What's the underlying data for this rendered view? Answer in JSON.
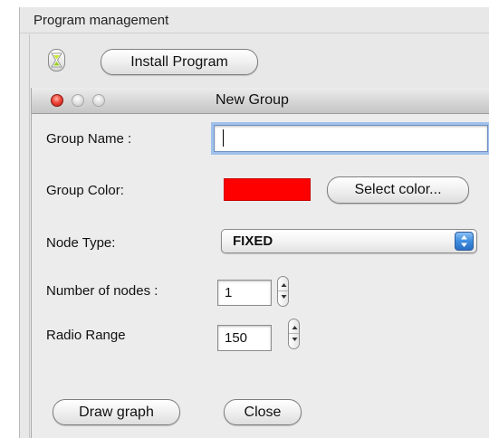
{
  "outer_window": {
    "title": "Program management",
    "install_button_label": "Install Program",
    "hourglass_icon": "hourglass-icon"
  },
  "dialog": {
    "title": "New Group",
    "traffic_lights": {
      "close_color": "#f0473a",
      "minimize_color": "#d4d4d4",
      "maximize_color": "#d4d4d4"
    },
    "group_name": {
      "label": "Group Name :",
      "value": "",
      "placeholder": ""
    },
    "group_color": {
      "label": "Group Color:",
      "swatch_color": "#ff0000",
      "select_button_label": "Select color..."
    },
    "node_type": {
      "label": "Node Type:",
      "selected": "FIXED"
    },
    "number_of_nodes": {
      "label": "Number of nodes :",
      "value": "1"
    },
    "radio_range": {
      "label": "Radio Range",
      "value": "150"
    },
    "draw_graph_label": "Draw graph",
    "close_label": "Close"
  },
  "colors": {
    "window_bg": "#e8e8e8",
    "focus_ring": "#9fc1ec",
    "select_accent": "#3e8de0"
  }
}
